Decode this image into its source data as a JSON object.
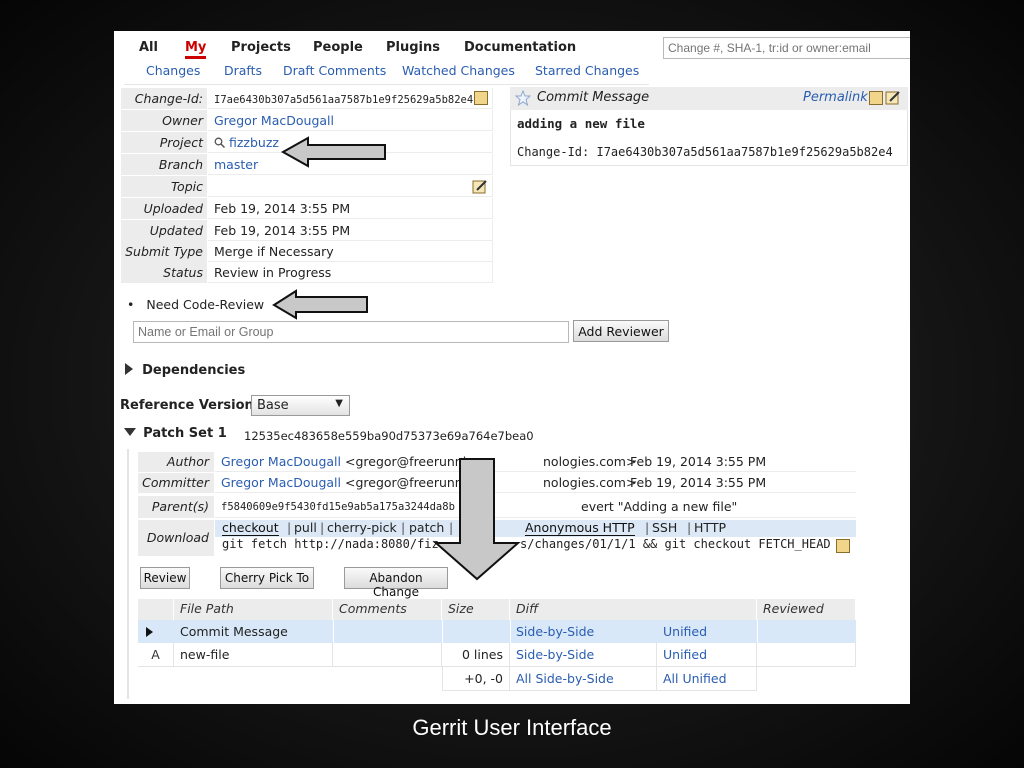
{
  "top_menu": {
    "all": "All",
    "my": "My",
    "projects": "Projects",
    "people": "People",
    "plugins": "Plugins",
    "documentation": "Documentation"
  },
  "sub_menu": {
    "changes": "Changes",
    "drafts": "Drafts",
    "draft_comments": "Draft Comments",
    "watched_changes": "Watched Changes",
    "starred_changes": "Starred Changes"
  },
  "search": {
    "placeholder": "Change #, SHA-1, tr:id or owner:email"
  },
  "info": {
    "change_id_label": "Change-Id:",
    "change_id": "I7ae6430b307a5d561aa7587b1e9f25629a5b82e4",
    "owner_label": "Owner",
    "owner": "Gregor MacDougall",
    "project_label": "Project",
    "project": "fizzbuzz",
    "branch_label": "Branch",
    "branch": "master",
    "topic_label": "Topic",
    "topic": "",
    "uploaded_label": "Uploaded",
    "uploaded": "Feb 19, 2014 3:55 PM",
    "updated_label": "Updated",
    "updated": "Feb 19, 2014 3:55 PM",
    "submit_type_label": "Submit Type",
    "submit_type": "Merge if Necessary",
    "status_label": "Status",
    "status": "Review in Progress"
  },
  "commit_message": {
    "title": "Commit Message",
    "permalink": "Permalink",
    "subject": "adding a new file",
    "change_id_line": "Change-Id: I7ae6430b307a5d561aa7587b1e9f25629a5b82e4"
  },
  "reviewers": {
    "need": "Need Code-Review",
    "input_placeholder": "Name or Email or Group",
    "add_button": "Add Reviewer"
  },
  "dependencies": {
    "label": "Dependencies"
  },
  "reference_version": {
    "label": "Reference Version:",
    "selected": "Base"
  },
  "patch_set": {
    "title": "Patch Set 1",
    "sha": "12535ec483658e559ba90d75373e69a764e7bea0",
    "author_label": "Author",
    "author_name": "Gregor MacDougall",
    "author_email": "<gregor@freerunni",
    "author_email_tail": "nologies.com>",
    "author_date": "Feb 19, 2014 3:55 PM",
    "committer_label": "Committer",
    "committer_name": "Gregor MacDougall",
    "committer_email": "<gregor@freerunni",
    "committer_email_tail": "nologies.com>",
    "committer_date": "Feb 19, 2014 3:55 PM",
    "parents_label": "Parent(s)",
    "parent_sha": "f5840609e9f5430fd15e9ab5a175a3244da8b",
    "parent_msg": "evert \"Adding a new file\"",
    "download_label": "Download",
    "download_tabs": [
      "checkout",
      "pull",
      "cherry-pick",
      "patch"
    ],
    "protocols": [
      "Anonymous HTTP",
      "SSH",
      "HTTP"
    ],
    "command_left": "git fetch http://nada:8080/fiz",
    "command_right": "s/changes/01/1/1 && git checkout FETCH_HEAD"
  },
  "actions": {
    "review": "Review",
    "cherry_pick": "Cherry Pick To",
    "abandon": "Abandon Change"
  },
  "files": {
    "headers": {
      "file_path": "File Path",
      "comments": "Comments",
      "size": "Size",
      "diff": "Diff",
      "reviewed": "Reviewed"
    },
    "rows": [
      {
        "status": "",
        "path": "Commit Message",
        "comments": "",
        "size": "",
        "sbs": "Side-by-Side",
        "unified": "Unified"
      },
      {
        "status": "A",
        "path": "new-file",
        "comments": "",
        "size": "0 lines",
        "sbs": "Side-by-Side",
        "unified": "Unified"
      }
    ],
    "total": {
      "size": "+0, -0",
      "sbs": "All Side-by-Side",
      "unified": "All Unified"
    }
  },
  "caption": "Gerrit User Interface",
  "colors": {
    "link": "#2a5db0",
    "selected_menu": "#cc0000",
    "highlight_row": "#d8e8f8",
    "arrow_fill": "#c8c8c8"
  }
}
